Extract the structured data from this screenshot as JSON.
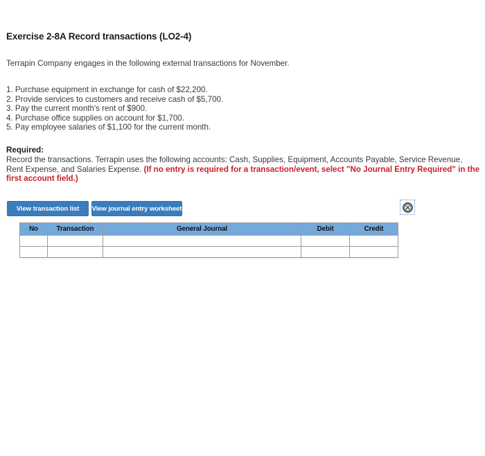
{
  "exercise": {
    "title": "Exercise 2-8A Record transactions (LO2-4)",
    "intro": "Terrapin Company engages in the following external transactions for November."
  },
  "transactions": [
    "1. Purchase equipment in exchange for cash of $22,200.",
    "2. Provide services to customers and receive cash of $5,700.",
    "3. Pay the current month's rent of $900.",
    "4. Purchase office supplies on account for $1,700.",
    "5. Pay employee salaries of $1,100 for the current month."
  ],
  "required": {
    "heading": "Required:",
    "body": "Record the transactions. Terrapin uses the following accounts: Cash, Supplies, Equipment, Accounts Payable, Service Revenue, Rent Expense, and Salaries Expense. ",
    "note": "(If no entry is required for a transaction/event, select \"No Journal Entry Required\" in the first account field.)",
    "note_color": "#c8202a"
  },
  "toolbar": {
    "transaction_list_label": "View transaction list",
    "journal_worksheet_label": "View journal entry worksheet",
    "button_color": "#3b7cbd",
    "close_icon": "circle-x-icon"
  },
  "journal": {
    "columns": [
      "No",
      "Transaction",
      "General Journal",
      "Debit",
      "Credit"
    ],
    "header_color": "#74a9dc",
    "rows": [
      {
        "no": "",
        "transaction": "",
        "general_journal": "",
        "debit": "",
        "credit": ""
      },
      {
        "no": "",
        "transaction": "",
        "general_journal": "",
        "debit": "",
        "credit": ""
      }
    ]
  }
}
